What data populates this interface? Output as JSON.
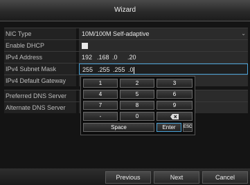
{
  "window": {
    "title": "Wizard"
  },
  "fields": [
    {
      "label": "NIC Type",
      "value": "10M/100M Self-adaptive"
    },
    {
      "label": "Enable DHCP",
      "checked": true
    },
    {
      "label": "IPv4 Address",
      "segments": [
        "192",
        ".168",
        ".0",
        ".20"
      ]
    },
    {
      "label": "IPv4 Subnet Mask",
      "segments": [
        "255",
        ".255",
        ".255",
        ".0"
      ]
    },
    {
      "label": "IPv4 Default Gateway"
    },
    {
      "label": "Preferred DNS Server"
    },
    {
      "label": "Alternate DNS Server"
    }
  ],
  "keypad": {
    "keys": [
      "1",
      "2",
      "3",
      "4",
      "5",
      "6",
      "7",
      "8",
      "9",
      "-",
      "0"
    ],
    "backspace_icon": "backspace-icon",
    "space": "Space",
    "enter": "Enter",
    "esc": "ESC"
  },
  "buttons": {
    "previous": "Previous",
    "next": "Next",
    "cancel": "Cancel"
  },
  "colors": {
    "accent": "#4aa3d8",
    "background": "#141414"
  }
}
